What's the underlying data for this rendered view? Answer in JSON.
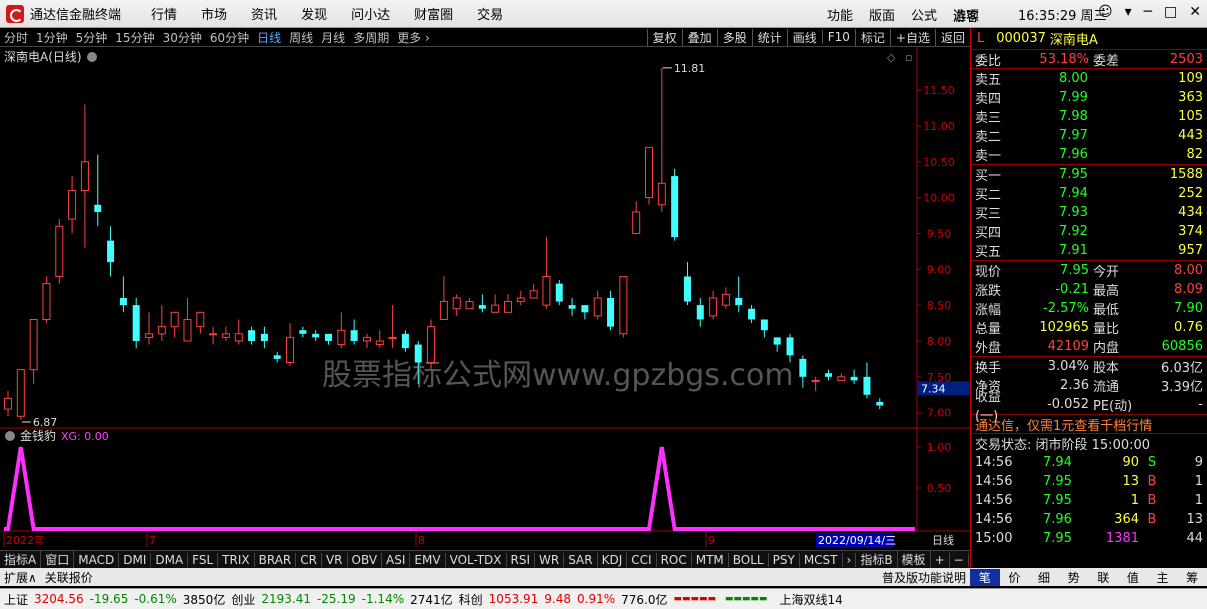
{
  "app": {
    "title": "通达信金融终端",
    "menu": [
      "行情",
      "市场",
      "资讯",
      "发现",
      "问小达",
      "财富圈",
      "交易"
    ],
    "rmenu": [
      "功能",
      "版面",
      "公式",
      "选项"
    ],
    "guest": "游客",
    "clock": "16:35:29 周三"
  },
  "toolbar": {
    "periods": [
      "分时",
      "1分钟",
      "5分钟",
      "15分钟",
      "30分钟",
      "60分钟",
      "日线",
      "周线",
      "月线",
      "多周期",
      "更多 ›"
    ],
    "active": "日线",
    "right": [
      "复权",
      "叠加",
      "多股",
      "统计",
      "画线",
      "F10",
      "标记",
      "+自选",
      "返回"
    ]
  },
  "chart": {
    "title": "深南电A(日线)",
    "hi_label": "11.81",
    "lo_label": "6.87",
    "price_axis": [
      "11.50",
      "11.00",
      "10.50",
      "10.00",
      "9.50",
      "9.00",
      "8.50",
      "8.00",
      "7.50",
      "7.00"
    ],
    "cur_tag": "7.34",
    "watermark": "股票指标公式网www.gpzbgs.com",
    "ind_title": "金钱豹",
    "ind_xg": "XG: 0.00",
    "ind_axis": [
      "1.00",
      "0.50"
    ],
    "xlabels": [
      "2022年",
      "7",
      "8",
      "9"
    ],
    "date_box": "2022/09/14/三",
    "period": "日线"
  },
  "bottom_tabs": [
    "指标A",
    "窗口",
    "MACD",
    "DMI",
    "DMA",
    "FSL",
    "TRIX",
    "BRAR",
    "CR",
    "VR",
    "OBV",
    "ASI",
    "EMV",
    "VOL-TDX",
    "RSI",
    "WR",
    "SAR",
    "KDJ",
    "CCI",
    "ROC",
    "MTM",
    "BOLL",
    "PSY",
    "MCST",
    "›",
    "指标B",
    "模板",
    "+",
    "−"
  ],
  "strip2": [
    "扩展∧",
    "关联报价"
  ],
  "strip2_right": "普及版功能说明",
  "quote": {
    "flag": "L",
    "code": "000037",
    "name": "深南电A",
    "weibi": {
      "l": "委比",
      "v": "53.18%",
      "l2": "委差",
      "v2": "2503"
    },
    "asks": [
      {
        "l": "卖五",
        "p": "8.00",
        "v": "109"
      },
      {
        "l": "卖四",
        "p": "7.99",
        "v": "363"
      },
      {
        "l": "卖三",
        "p": "7.98",
        "v": "105"
      },
      {
        "l": "卖二",
        "p": "7.97",
        "v": "443"
      },
      {
        "l": "卖一",
        "p": "7.96",
        "v": "82"
      }
    ],
    "bids": [
      {
        "l": "买一",
        "p": "7.95",
        "v": "1588"
      },
      {
        "l": "买二",
        "p": "7.94",
        "v": "252"
      },
      {
        "l": "买三",
        "p": "7.93",
        "v": "434"
      },
      {
        "l": "买四",
        "p": "7.92",
        "v": "374"
      },
      {
        "l": "买五",
        "p": "7.91",
        "v": "957"
      }
    ],
    "stats": [
      {
        "l": "现价",
        "v": "7.95",
        "l2": "今开",
        "v2": "8.00"
      },
      {
        "l": "涨跌",
        "v": "-0.21",
        "l2": "最高",
        "v2": "8.09"
      },
      {
        "l": "涨幅",
        "v": "-2.57%",
        "l2": "最低",
        "v2": "7.90"
      },
      {
        "l": "总量",
        "v": "102965",
        "l2": "量比",
        "v2": "0.76"
      },
      {
        "l": "外盘",
        "v": "42109",
        "l2": "内盘",
        "v2": "60856"
      }
    ],
    "stats2": [
      {
        "l": "换手",
        "v": "3.04%",
        "l2": "股本",
        "v2": "6.03亿"
      },
      {
        "l": "净资",
        "v": "2.36",
        "l2": "流通",
        "v2": "3.39亿"
      },
      {
        "l": "收益(一)",
        "v": "-0.052",
        "l2": "PE(动)",
        "v2": "-"
      }
    ],
    "promo": "通达信，仅需1元查看千档行情",
    "trade_state": "交易状态: 闭市阶段 15:00:00",
    "ticks": [
      {
        "t": "14:56",
        "p": "7.94",
        "v": "90",
        "s": "S",
        "n": "9"
      },
      {
        "t": "14:56",
        "p": "7.95",
        "v": "13",
        "s": "B",
        "n": "1"
      },
      {
        "t": "14:56",
        "p": "7.95",
        "v": "1",
        "s": "B",
        "n": "1"
      },
      {
        "t": "14:56",
        "p": "7.96",
        "v": "364",
        "s": "B",
        "n": "13"
      },
      {
        "t": "15:00",
        "p": "7.95",
        "v": "1381",
        "s": "",
        "n": "44"
      }
    ]
  },
  "rtabs": [
    "笔",
    "价",
    "细",
    "势",
    "联",
    "值",
    "主",
    "筹"
  ],
  "status": [
    {
      "t": "上证",
      "c": ""
    },
    {
      "t": "3204.56",
      "c": "sred"
    },
    {
      "t": "-19.65",
      "c": "sgrn"
    },
    {
      "t": "-0.61%",
      "c": "sgrn"
    },
    {
      "t": "3850亿",
      "c": ""
    },
    {
      "t": "创业",
      "c": ""
    },
    {
      "t": "2193.41",
      "c": "sgrn"
    },
    {
      "t": "-25.19",
      "c": "sgrn"
    },
    {
      "t": "-1.14%",
      "c": "sgrn"
    },
    {
      "t": "2741亿",
      "c": ""
    },
    {
      "t": "科创",
      "c": ""
    },
    {
      "t": "1053.91",
      "c": "sred"
    },
    {
      "t": "9.48",
      "c": "sred"
    },
    {
      "t": "0.91%",
      "c": "sred"
    },
    {
      "t": "776.0亿",
      "c": ""
    },
    {
      "t": "上海双线14",
      "c": ""
    }
  ],
  "chart_data": {
    "type": "candlestick",
    "candles": [
      [
        7.05,
        7.2,
        7.3,
        6.95
      ],
      [
        6.95,
        7.6,
        7.6,
        6.9
      ],
      [
        7.6,
        8.3,
        8.3,
        7.4
      ],
      [
        8.3,
        8.8,
        8.9,
        8.25
      ],
      [
        8.9,
        9.6,
        9.7,
        8.8
      ],
      [
        9.7,
        10.1,
        10.3,
        9.5
      ],
      [
        10.1,
        10.5,
        11.3,
        9.3
      ],
      [
        9.9,
        9.8,
        10.6,
        9.6
      ],
      [
        9.4,
        9.1,
        9.6,
        8.9
      ],
      [
        8.6,
        8.5,
        8.9,
        8.4
      ],
      [
        8.5,
        8.0,
        8.6,
        7.9
      ],
      [
        8.05,
        8.1,
        8.4,
        7.95
      ],
      [
        8.1,
        8.2,
        8.5,
        8.0
      ],
      [
        8.2,
        8.4,
        8.4,
        8.05
      ],
      [
        8.0,
        8.3,
        8.6,
        8.0
      ],
      [
        8.2,
        8.4,
        8.4,
        8.1
      ],
      [
        8.1,
        8.1,
        8.2,
        7.95
      ],
      [
        8.05,
        8.1,
        8.2,
        8.0
      ],
      [
        8.0,
        8.1,
        8.3,
        7.95
      ],
      [
        8.15,
        8.0,
        8.2,
        7.95
      ],
      [
        8.1,
        8.0,
        8.2,
        7.9
      ],
      [
        7.8,
        7.75,
        7.85,
        7.7
      ],
      [
        7.7,
        8.05,
        8.25,
        7.65
      ],
      [
        8.15,
        8.1,
        8.2,
        8.05
      ],
      [
        8.1,
        8.05,
        8.15,
        8.0
      ],
      [
        8.1,
        8.0,
        8.05,
        7.95
      ],
      [
        7.95,
        8.15,
        8.4,
        7.9
      ],
      [
        8.15,
        8.0,
        8.3,
        7.95
      ],
      [
        8.0,
        8.05,
        8.1,
        7.9
      ],
      [
        7.95,
        8.0,
        8.15,
        7.9
      ],
      [
        8.05,
        8.05,
        8.5,
        7.9
      ],
      [
        8.1,
        7.9,
        8.15,
        7.85
      ],
      [
        7.95,
        7.7,
        8.0,
        7.4
      ],
      [
        7.7,
        8.2,
        8.3,
        7.6
      ],
      [
        8.3,
        8.55,
        8.9,
        8.3
      ],
      [
        8.45,
        8.6,
        8.65,
        8.35
      ],
      [
        8.45,
        8.55,
        8.6,
        8.45
      ],
      [
        8.5,
        8.45,
        8.65,
        8.4
      ],
      [
        8.4,
        8.5,
        8.65,
        8.4
      ],
      [
        8.4,
        8.55,
        8.65,
        8.4
      ],
      [
        8.55,
        8.6,
        8.7,
        8.5
      ],
      [
        8.6,
        8.7,
        8.8,
        8.6
      ],
      [
        8.5,
        8.9,
        9.45,
        8.45
      ],
      [
        8.8,
        8.55,
        8.85,
        8.5
      ],
      [
        8.5,
        8.45,
        8.6,
        8.35
      ],
      [
        8.5,
        8.4,
        8.5,
        8.3
      ],
      [
        8.35,
        8.6,
        8.7,
        8.3
      ],
      [
        8.6,
        8.2,
        8.7,
        8.15
      ],
      [
        8.1,
        8.9,
        8.9,
        8.05
      ],
      [
        9.5,
        9.8,
        9.95,
        9.5
      ],
      [
        10.0,
        10.7,
        10.7,
        9.9
      ],
      [
        9.9,
        10.2,
        11.81,
        9.8
      ],
      [
        10.3,
        9.45,
        10.4,
        9.4
      ],
      [
        8.9,
        8.55,
        9.1,
        8.5
      ],
      [
        8.5,
        8.3,
        8.6,
        8.2
      ],
      [
        8.35,
        8.6,
        8.7,
        8.3
      ],
      [
        8.5,
        8.65,
        8.75,
        8.45
      ],
      [
        8.6,
        8.5,
        8.9,
        8.4
      ],
      [
        8.45,
        8.3,
        8.5,
        8.25
      ],
      [
        8.3,
        8.15,
        8.3,
        8.05
      ],
      [
        8.05,
        7.95,
        8.0,
        7.85
      ],
      [
        8.05,
        7.8,
        8.1,
        7.7
      ],
      [
        7.75,
        7.5,
        7.8,
        7.35
      ],
      [
        7.45,
        7.45,
        7.5,
        7.3
      ],
      [
        7.55,
        7.5,
        7.6,
        7.45
      ],
      [
        7.45,
        7.5,
        7.55,
        7.45
      ],
      [
        7.5,
        7.45,
        7.6,
        7.4
      ],
      [
        7.5,
        7.25,
        7.7,
        7.2
      ],
      [
        7.15,
        7.1,
        7.2,
        7.05
      ]
    ],
    "signals": [
      1,
      51
    ]
  }
}
